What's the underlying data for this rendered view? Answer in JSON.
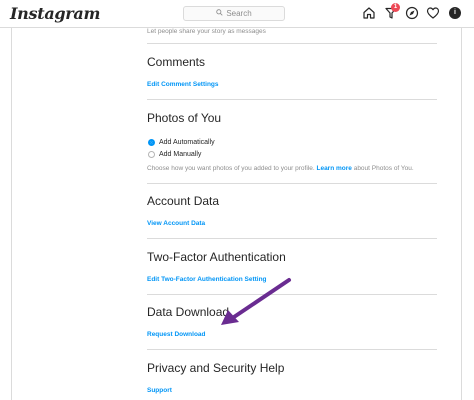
{
  "header": {
    "logo": "Instagram",
    "search_placeholder": "Search",
    "notification_count": "1",
    "avatar_letter": "i"
  },
  "settings": {
    "story_messages_desc": "Let people share your story as messages",
    "comments": {
      "heading": "Comments",
      "link": "Edit Comment Settings"
    },
    "photos_of_you": {
      "heading": "Photos of You",
      "option_auto": "Add Automatically",
      "option_manual": "Add Manually",
      "desc_before": "Choose how you want photos of you added to your profile.",
      "learn_more": "Learn more",
      "desc_after": "about Photos of You."
    },
    "account_data": {
      "heading": "Account Data",
      "link": "View Account Data"
    },
    "two_factor": {
      "heading": "Two-Factor Authentication",
      "link": "Edit Two-Factor Authentication Setting"
    },
    "data_download": {
      "heading": "Data Download",
      "link": "Request Download"
    },
    "privacy_help": {
      "heading": "Privacy and Security Help",
      "link": "Support"
    }
  },
  "colors": {
    "link": "#0095f6",
    "annotation_arrow": "#6a2c91",
    "badge": "#ed4956"
  }
}
